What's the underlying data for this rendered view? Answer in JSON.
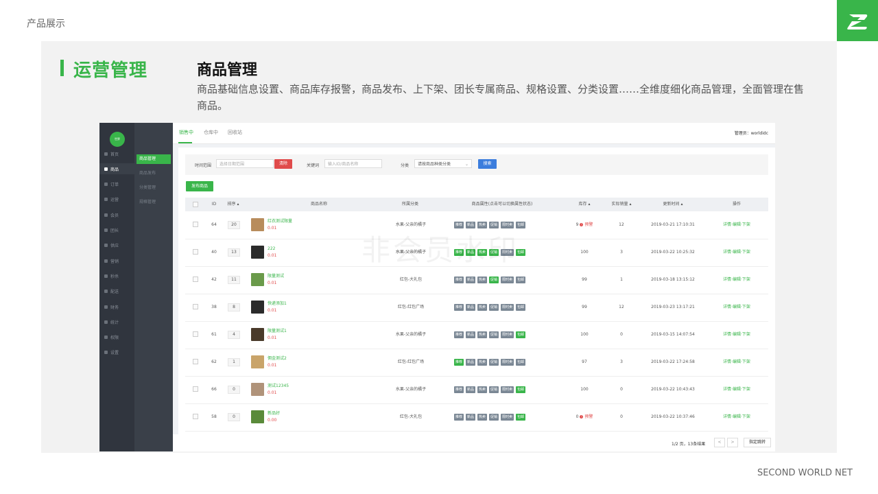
{
  "header": {
    "page_label": "产品展示",
    "brand": "SECOND WORLD NET"
  },
  "section": {
    "title": "运营管理",
    "feature_title": "商品管理",
    "feature_desc": "商品基础信息设置、商品库存报警，商品发布、上下架、团长专属商品、规格设置、分类设置……全维度细化商品管理，全面管理在售商品。"
  },
  "app": {
    "avatar_text": "世界",
    "sidebar": [
      {
        "label": "首页"
      },
      {
        "label": "商品"
      },
      {
        "label": "订单"
      },
      {
        "label": "运营"
      },
      {
        "label": "会员"
      },
      {
        "label": "团长"
      },
      {
        "label": "供应"
      },
      {
        "label": "营销"
      },
      {
        "label": "秒杀"
      },
      {
        "label": "配送"
      },
      {
        "label": "财务"
      },
      {
        "label": "统计"
      },
      {
        "label": "权限"
      },
      {
        "label": "设置"
      }
    ],
    "submenu": [
      {
        "label": "商品管理"
      },
      {
        "label": "商品发布"
      },
      {
        "label": "分类管理"
      },
      {
        "label": "规格管理"
      }
    ],
    "tabs": [
      {
        "label": "销售中"
      },
      {
        "label": "仓库中"
      },
      {
        "label": "回收站"
      }
    ],
    "admin": "管理员：worldidc",
    "filter": {
      "time_label": "时间范围",
      "time_placeholder": "选择日期范围",
      "clear_label": "清除",
      "keyword_label": "关键词",
      "keyword_placeholder": "输入ID/商品名称",
      "category_label": "分类",
      "category_value": "请按商品种类分类",
      "search_label": "搜索"
    },
    "publish_label": "发布商品",
    "columns": {
      "id": "ID",
      "sort": "排序",
      "name": "商品名称",
      "category": "所属分类",
      "attrs": "商品属性(点击可以切换属性状态)",
      "stock": "库存",
      "sales": "实际销量",
      "updated": "更新时间",
      "ops": "操作"
    },
    "tag_labels": [
      "推荐",
      "新品",
      "热卖",
      "促销",
      "限时卖",
      "包邮"
    ],
    "rows": [
      {
        "id": "64",
        "sort": "20",
        "name": "红衣测试限量",
        "price": "0.01",
        "category": "水果-父亲的橘子",
        "tags": [
          false,
          false,
          false,
          false,
          false,
          false
        ],
        "stock": "9",
        "stock_warn": "预警",
        "sales": "12",
        "updated": "2019-03-21 17:10:31",
        "thumb": "#b88c5c"
      },
      {
        "id": "40",
        "sort": "13",
        "name": "222",
        "price": "0.01",
        "category": "水果-父亲的橘子",
        "tags": [
          true,
          true,
          true,
          true,
          false,
          true
        ],
        "stock": "100",
        "stock_warn": "",
        "sales": "3",
        "updated": "2019-03-22 10:25:32",
        "thumb": "#2b2b2b"
      },
      {
        "id": "42",
        "sort": "11",
        "name": "限量测试",
        "price": "0.01",
        "category": "红包-大礼包",
        "tags": [
          false,
          false,
          false,
          true,
          false,
          false
        ],
        "stock": "99",
        "stock_warn": "",
        "sales": "1",
        "updated": "2019-03-18 13:15:12",
        "thumb": "#6a9a4a"
      },
      {
        "id": "38",
        "sort": "8",
        "name": "快递添加1",
        "price": "0.01",
        "category": "红包-红包广场",
        "tags": [
          false,
          false,
          false,
          false,
          false,
          false
        ],
        "stock": "99",
        "stock_warn": "",
        "sales": "12",
        "updated": "2019-03-23 13:17:21",
        "thumb": "#2b2b2b"
      },
      {
        "id": "61",
        "sort": "4",
        "name": "限量测试1",
        "price": "0.01",
        "category": "水果-父亲的橘子",
        "tags": [
          false,
          false,
          false,
          false,
          false,
          true
        ],
        "stock": "100",
        "stock_warn": "",
        "sales": "0",
        "updated": "2019-03-15 14:07:54",
        "thumb": "#4a3a2a"
      },
      {
        "id": "62",
        "sort": "1",
        "name": "佣金测试2",
        "price": "0.01",
        "category": "红包-红包广场",
        "tags": [
          true,
          false,
          false,
          false,
          false,
          false
        ],
        "stock": "97",
        "stock_warn": "",
        "sales": "3",
        "updated": "2019-03-22 17:24:58",
        "thumb": "#c9a46a"
      },
      {
        "id": "66",
        "sort": "0",
        "name": "测试12345",
        "price": "0.01",
        "category": "水果-父亲的橘子",
        "tags": [
          false,
          false,
          false,
          false,
          false,
          true
        ],
        "stock": "100",
        "stock_warn": "",
        "sales": "0",
        "updated": "2019-03-22 10:43:43",
        "thumb": "#b0937a"
      },
      {
        "id": "58",
        "sort": "0",
        "name": "新品好",
        "price": "0.00",
        "category": "红包-大礼包",
        "tags": [
          false,
          false,
          false,
          false,
          false,
          true
        ],
        "stock": "0",
        "stock_warn": "预警",
        "sales": "0",
        "updated": "2019-03-22 10:37:46",
        "thumb": "#5a8a3a"
      }
    ],
    "ops": {
      "detail": "详情",
      "edit": "编辑",
      "off": "下架"
    },
    "pagination": {
      "info": "1/2 页，13条结果",
      "prev": "<",
      "next": ">",
      "jump": "指定跳转"
    },
    "watermark": "非会员水印"
  },
  "colors": {
    "accent": "#39b54a",
    "danger": "#e04b4b",
    "primary": "#3b7ddd"
  }
}
